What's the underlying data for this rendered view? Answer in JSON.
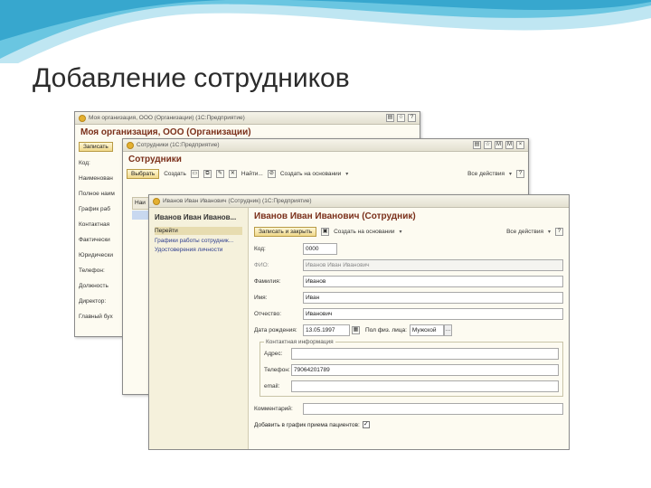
{
  "slide": {
    "title": "Добавление сотрудников"
  },
  "colors": {
    "accent": "#e4b030",
    "header_text": "#7a2f1a",
    "link": "#2f3f8f"
  },
  "win1": {
    "title": "Моя организация, ООО (Организации)  (1С:Предприятие)",
    "header": "Моя организация, ООО (Организации)",
    "toolbar": {
      "save": "Записать"
    },
    "fields": [
      "Код:",
      "Наименован",
      "Полное наим",
      "График раб",
      "Контактная",
      "Фактически",
      "Юридически",
      "Телефон:",
      "Должность",
      "Директор:",
      "Главный бух"
    ]
  },
  "win2": {
    "title": "Сотрудники  (1С:Предприятие)",
    "header": "Сотрудники",
    "toolbar": {
      "choose": "Выбрать",
      "create": "Создать",
      "find": "Найти...",
      "create_basis": "Создать на основании",
      "all_actions": "Все действия"
    },
    "col_header": "Наи"
  },
  "win3": {
    "title": "Иванов Иван Иванович (Сотрудник)  (1С:Предприятие)",
    "nav": {
      "title": "Иванов Иван Иванов...",
      "items": [
        "Перейти",
        "Графики работы сотрудник...",
        "Удостоверения личности"
      ]
    },
    "header": "Иванов Иван Иванович (Сотрудник)",
    "toolbar": {
      "save_close": "Записать и закрыть",
      "create_basis": "Создать на основании",
      "all_actions": "Все действия"
    },
    "fields": {
      "code_label": "Код:",
      "code_value": "0000",
      "fio_label": "ФИО:",
      "fio_value": "Иванов Иван Иванович",
      "surname_label": "Фамилия:",
      "surname_value": "Иванов",
      "name_label": "Имя:",
      "name_value": "Иван",
      "patronymic_label": "Отчество:",
      "patronymic_value": "Иванович",
      "birth_label": "Дата рождения:",
      "birth_value": "13.05.1997",
      "gender_label": "Пол физ. лица:",
      "gender_value": "Мужской"
    },
    "contacts": {
      "title": "Контактная информация",
      "address_label": "Адрес:",
      "address_value": "",
      "phone_label": "Телефон:",
      "phone_value": "79064201789",
      "email_label": "email:",
      "email_value": ""
    },
    "comment_label": "Комментарий:",
    "comment_value": "",
    "checkbox_label": "Добавить в график приема пациентов:"
  }
}
